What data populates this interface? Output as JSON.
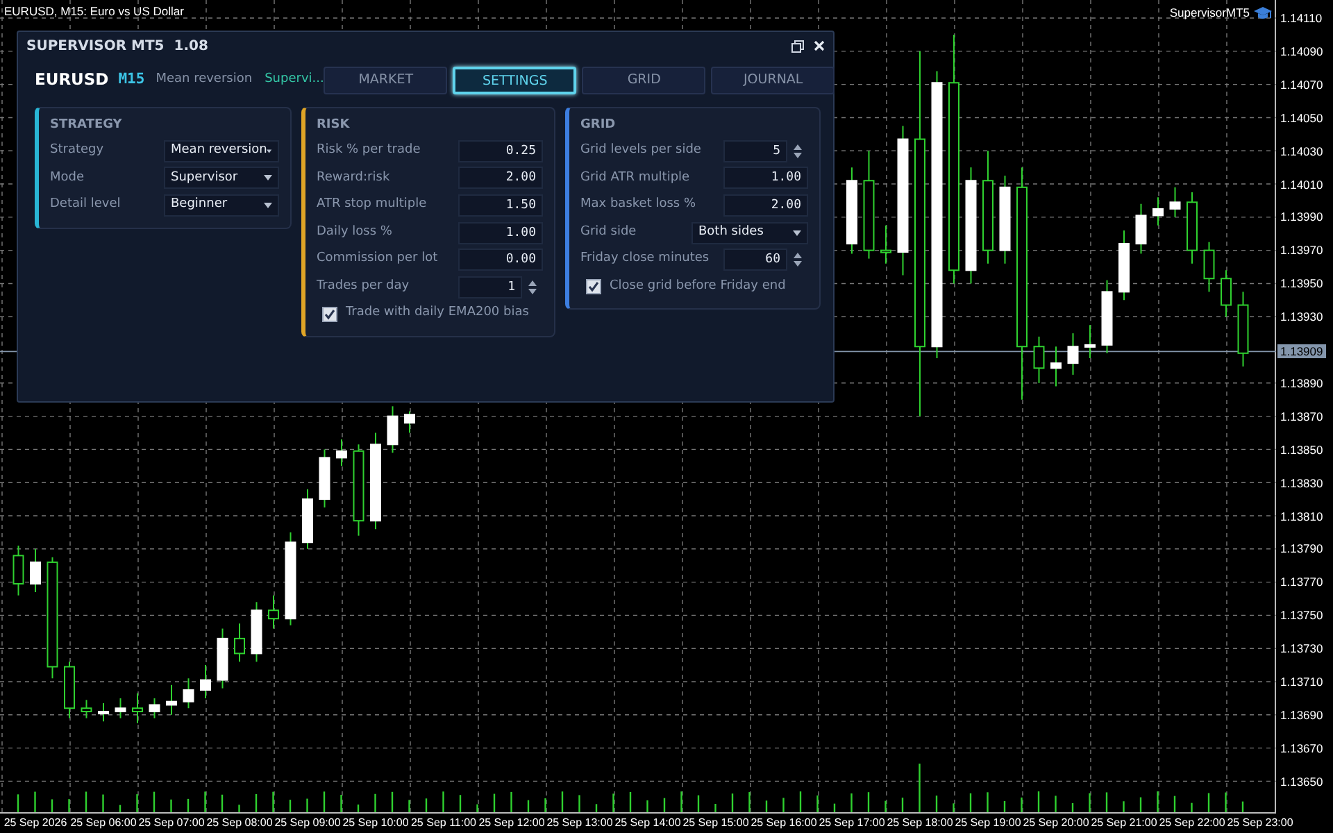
{
  "chart": {
    "title": "EURUSD, M15:  Euro vs US Dollar",
    "expert": "SupervisorMT5",
    "chart_data": {
      "type": "candlestick",
      "grid": true,
      "ref_lines": [
        {
          "axis": "y",
          "value": 1.13909,
          "label": "1.13909",
          "color": "#8496ac"
        }
      ],
      "categories": [
        null,
        null,
        "25 Sep 2026",
        null,
        null,
        null,
        "25 Sep 06:00",
        null,
        null,
        null,
        "25 Sep 07:00",
        null,
        null,
        null,
        "25 Sep 08:00",
        null,
        null,
        null,
        "25 Sep 09:00",
        null,
        null,
        null,
        "25 Sep 10:00",
        null,
        null,
        null,
        "25 Sep 11:00",
        null,
        null,
        null,
        "25 Sep 12:00",
        null,
        null,
        null,
        "25 Sep 13:00",
        null,
        null,
        null,
        "25 Sep 14:00",
        null,
        null,
        null,
        "25 Sep 15:00",
        null,
        null,
        null,
        "25 Sep 16:00",
        null,
        null,
        null,
        "25 Sep 17:00",
        null,
        null,
        null,
        "25 Sep 18:00",
        null,
        null,
        null,
        "25 Sep 19:00",
        null,
        null,
        null,
        "25 Sep 20:00",
        null,
        null,
        null,
        "25 Sep 21:00",
        null,
        null,
        null,
        "25 Sep 22:00",
        null,
        null,
        null,
        "25 Sep 23:00"
      ],
      "ohlc": [
        null,
        [
          1.13786,
          1.13792,
          1.13762,
          1.13769
        ],
        [
          1.13769,
          1.1379,
          1.13764,
          1.13782
        ],
        [
          1.13782,
          1.13785,
          1.13712,
          1.13719
        ],
        [
          1.13719,
          1.13722,
          1.13688,
          1.13694
        ],
        [
          1.13694,
          1.13699,
          1.13688,
          1.13692
        ],
        [
          1.13692,
          1.13697,
          1.13686,
          1.13692
        ],
        [
          1.13692,
          1.137,
          1.13688,
          1.13694
        ],
        [
          1.13694,
          1.13703,
          1.13685,
          1.13692
        ],
        [
          1.13692,
          1.137,
          1.13688,
          1.13696
        ],
        [
          1.13696,
          1.13708,
          1.1369,
          1.13698
        ],
        [
          1.13698,
          1.13712,
          1.13694,
          1.13705
        ],
        [
          1.13705,
          1.1372,
          1.137,
          1.13711
        ],
        [
          1.13711,
          1.13742,
          1.13706,
          1.13736
        ],
        [
          1.13736,
          1.13745,
          1.13722,
          1.13727
        ],
        [
          1.13727,
          1.13758,
          1.13722,
          1.13753
        ],
        [
          1.13753,
          1.13762,
          1.13742,
          1.13748
        ],
        [
          1.13748,
          1.138,
          1.13744,
          1.13794
        ],
        [
          1.13794,
          1.13826,
          1.1379,
          1.1382
        ],
        [
          1.1382,
          1.1385,
          1.13815,
          1.13845
        ],
        [
          1.13845,
          1.13856,
          1.1384,
          1.13849
        ],
        [
          1.13849,
          1.13853,
          1.13798,
          1.13807
        ],
        [
          1.13807,
          1.1386,
          1.13802,
          1.13853
        ],
        [
          1.13853,
          1.13876,
          1.13848,
          1.1387
        ],
        [
          1.13866,
          1.13873,
          1.1386,
          1.13871
        ],
        null,
        null,
        null,
        null,
        null,
        null,
        null,
        null,
        null,
        null,
        null,
        null,
        null,
        null,
        null,
        null,
        null,
        null,
        null,
        null,
        null,
        null,
        null,
        null,
        null,
        [
          1.13974,
          1.1402,
          1.13968,
          1.14012
        ],
        [
          1.14012,
          1.1403,
          1.13965,
          1.1397
        ],
        [
          1.1397,
          1.13985,
          1.13962,
          1.13969
        ],
        [
          1.13969,
          1.14045,
          1.13955,
          1.14037
        ],
        [
          1.14037,
          1.1409,
          1.1387,
          1.13912
        ],
        [
          1.13912,
          1.14078,
          1.13905,
          1.14071
        ],
        [
          1.14071,
          1.141,
          1.1395,
          1.13958
        ],
        [
          1.13958,
          1.1402,
          1.1395,
          1.14012
        ],
        [
          1.14012,
          1.1403,
          1.13962,
          1.1397
        ],
        [
          1.1397,
          1.14015,
          1.13962,
          1.14008
        ],
        [
          1.14008,
          1.1402,
          1.1388,
          1.13912
        ],
        [
          1.13912,
          1.13918,
          1.1389,
          1.13899
        ],
        [
          1.13899,
          1.13912,
          1.13888,
          1.13902
        ],
        [
          1.13902,
          1.1392,
          1.13895,
          1.13912
        ],
        [
          1.13912,
          1.13925,
          1.13905,
          1.13913
        ],
        [
          1.13913,
          1.13952,
          1.13908,
          1.13945
        ],
        [
          1.13945,
          1.13982,
          1.1394,
          1.13974
        ],
        [
          1.13974,
          1.13998,
          1.13968,
          1.13991
        ],
        [
          1.13991,
          1.14002,
          1.13985,
          1.13995
        ],
        [
          1.13995,
          1.14008,
          1.1399,
          1.13999
        ],
        [
          1.13999,
          1.14005,
          1.13962,
          1.1397
        ],
        [
          1.1397,
          1.13975,
          1.13945,
          1.13953
        ],
        [
          1.13953,
          1.13958,
          1.1393,
          1.13937
        ],
        [
          1.13937,
          1.13945,
          1.139,
          1.13908
        ],
        null
      ],
      "ylim": [
        1.136305,
        1.141209
      ],
      "yticks": [
        {
          "value": 1.1411,
          "label": "1.14110"
        },
        {
          "value": 1.1409,
          "label": "1.14090"
        },
        {
          "value": 1.1407,
          "label": "1.14070"
        },
        {
          "value": 1.1405,
          "label": "1.14050"
        },
        {
          "value": 1.1403,
          "label": "1.14030"
        },
        {
          "value": 1.1401,
          "label": "1.14010"
        },
        {
          "value": 1.1399,
          "label": "1.13990"
        },
        {
          "value": 1.1397,
          "label": "1.13970"
        },
        {
          "value": 1.1395,
          "label": "1.13950"
        },
        {
          "value": 1.1393,
          "label": "1.13930"
        },
        {
          "value": 1.1389,
          "label": "1.13890"
        },
        {
          "value": 1.1387,
          "label": "1.13870"
        },
        {
          "value": 1.1385,
          "label": "1.13850"
        },
        {
          "value": 1.1383,
          "label": "1.13830"
        },
        {
          "value": 1.1381,
          "label": "1.13810"
        },
        {
          "value": 1.1379,
          "label": "1.13790"
        },
        {
          "value": 1.1377,
          "label": "1.13770"
        },
        {
          "value": 1.1375,
          "label": "1.13750"
        },
        {
          "value": 1.1373,
          "label": "1.13730"
        },
        {
          "value": 1.1371,
          "label": "1.13710"
        },
        {
          "value": 1.1369,
          "label": "1.13690"
        },
        {
          "value": 1.1367,
          "label": "1.13670"
        },
        {
          "value": 1.1365,
          "label": "1.13650"
        }
      ]
    }
  },
  "panel": {
    "title": "SUPERVISOR MT5",
    "version": "1.08",
    "symbol": "EURUSD",
    "timeframe": "M15",
    "strategy": "Mean reversion",
    "mode": "Supervi...",
    "tabs": [
      {
        "label": "MARKET",
        "selected": false
      },
      {
        "label": "SETTINGS",
        "selected": true
      },
      {
        "label": "GRID",
        "selected": false
      },
      {
        "label": "JOURNAL",
        "selected": false
      }
    ],
    "sections": [
      {
        "title": "STRATEGY",
        "color": "#29b6d6",
        "rows": [
          {
            "kind": "select",
            "label": "Strategy",
            "value": "Mean reversion"
          },
          {
            "kind": "select",
            "label": "Mode",
            "value": "Supervisor"
          },
          {
            "kind": "select",
            "label": "Detail level",
            "value": "Beginner"
          }
        ]
      },
      {
        "title": "RISK",
        "color": "#e0a526",
        "rows": [
          {
            "kind": "number",
            "label": "Risk % per trade",
            "value": "0.25"
          },
          {
            "kind": "number",
            "label": "Reward:risk",
            "value": "2.00"
          },
          {
            "kind": "number",
            "label": "ATR stop multiple",
            "value": "1.50"
          },
          {
            "kind": "number",
            "label": "Daily loss %",
            "value": "1.00"
          },
          {
            "kind": "number",
            "label": "Commission per lot",
            "value": "0.00"
          },
          {
            "kind": "spin",
            "label": "Trades per day",
            "value": "1"
          },
          {
            "kind": "checkbox",
            "label": "Trade with daily EMA200 bias",
            "checked": true
          }
        ]
      },
      {
        "title": "GRID",
        "color": "#3d7ee0",
        "rows": [
          {
            "kind": "spin",
            "label": "Grid levels per side",
            "value": "5"
          },
          {
            "kind": "number",
            "label": "Grid ATR multiple",
            "value": "1.00"
          },
          {
            "kind": "number",
            "label": "Max basket loss %",
            "value": "2.00"
          },
          {
            "kind": "select",
            "label": "Grid side",
            "value": "Both sides"
          },
          {
            "kind": "spin",
            "label": "Friday close minutes",
            "value": "60"
          },
          {
            "kind": "checkbox",
            "label": "Close grid before Friday end",
            "checked": true
          }
        ]
      }
    ]
  }
}
